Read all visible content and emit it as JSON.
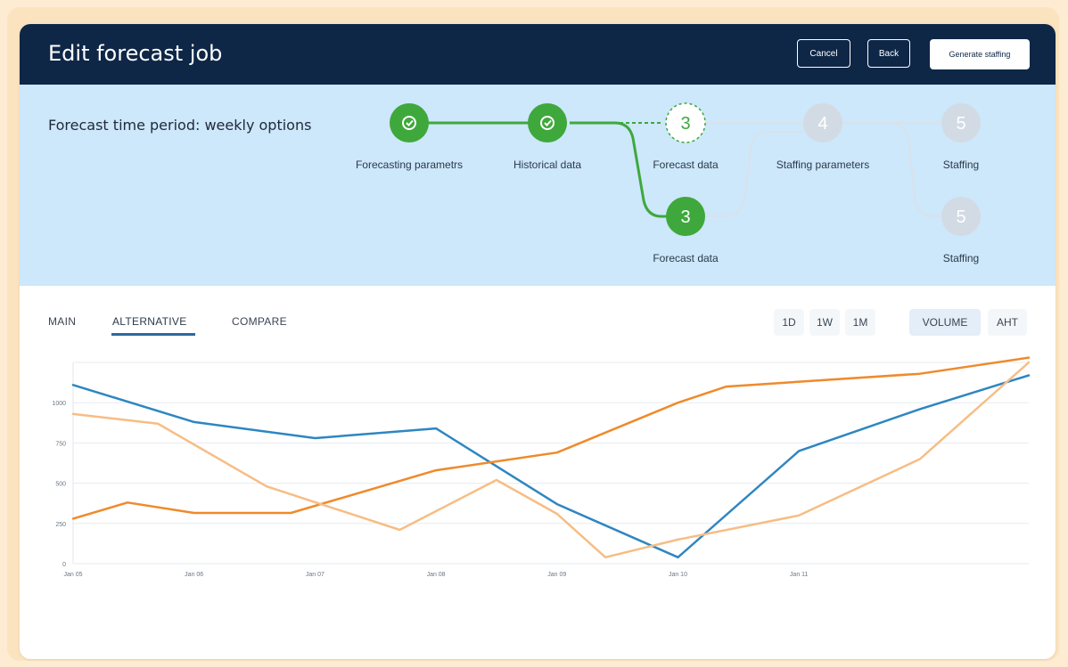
{
  "header": {
    "title": "Edit forecast job",
    "cancel_label": "Cancel",
    "back_label": "Back",
    "generate_label": "Generate staffing"
  },
  "stepper": {
    "period_title": "Forecast time period: weekly options",
    "steps": [
      {
        "number": "",
        "label": "Forecasting parametrs",
        "state": "complete"
      },
      {
        "number": "",
        "label": "Historical data",
        "state": "complete"
      },
      {
        "number": "3",
        "label": "Forecast data",
        "state": "current-alt"
      },
      {
        "number": "4",
        "label": "Staffing parameters",
        "state": "pending"
      },
      {
        "number": "5",
        "label": "Staffing",
        "state": "pending"
      },
      {
        "number": "3",
        "label": "Forecast data",
        "state": "current"
      },
      {
        "number": "5",
        "label": "Staffing",
        "state": "pending"
      }
    ],
    "colors": {
      "complete": "#3fa83c",
      "pending": "#d2dbe4",
      "panel": "#cde7fb"
    }
  },
  "tabs": [
    {
      "label": "MAIN",
      "active": false
    },
    {
      "label": "ALTERNATIVE",
      "active": true
    },
    {
      "label": "COMPARE",
      "active": false
    }
  ],
  "range_buttons": [
    "1D",
    "1W",
    "1M"
  ],
  "metric_buttons": [
    {
      "label": "VOLUME",
      "selected": true
    },
    {
      "label": "AHT",
      "selected": false
    }
  ],
  "chart_data": {
    "type": "line",
    "x": [
      "Jan 05",
      "Jan 06",
      "Jan 07",
      "Jan 08",
      "Jan 09",
      "Jan 10",
      "Jan 11"
    ],
    "ylim": [
      0,
      1250
    ],
    "yticks": [
      "0",
      "250",
      "500",
      "750",
      "1000"
    ],
    "series": [
      {
        "color": "#2e86c1",
        "points": [
          [
            0,
            1110
          ],
          [
            1,
            880
          ],
          [
            2,
            780
          ],
          [
            3,
            840
          ],
          [
            4,
            370
          ],
          [
            5,
            40
          ],
          [
            6,
            700
          ],
          [
            7,
            960
          ],
          [
            7.9,
            1170
          ]
        ]
      },
      {
        "color": "#ef8a2b",
        "points": [
          [
            0,
            280
          ],
          [
            0.45,
            380
          ],
          [
            1,
            315
          ],
          [
            1.8,
            315
          ],
          [
            3,
            580
          ],
          [
            4,
            690
          ],
          [
            5,
            1000
          ],
          [
            5.4,
            1100
          ],
          [
            7,
            1180
          ],
          [
            7.9,
            1280
          ]
        ]
      },
      {
        "color": "#f7bd84",
        "points": [
          [
            0,
            930
          ],
          [
            0.7,
            870
          ],
          [
            1.6,
            480
          ],
          [
            2.7,
            210
          ],
          [
            3.5,
            520
          ],
          [
            4,
            310
          ],
          [
            4.4,
            40
          ],
          [
            5,
            150
          ],
          [
            6,
            300
          ],
          [
            7,
            650
          ],
          [
            7.9,
            1250
          ]
        ]
      }
    ],
    "grid": true,
    "legend": "none"
  }
}
